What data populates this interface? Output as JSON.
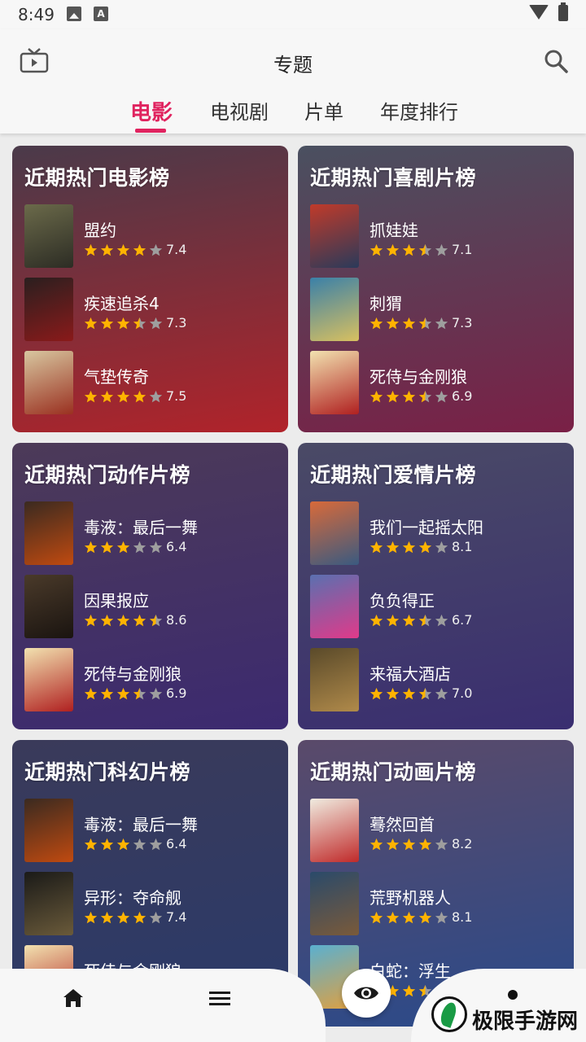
{
  "status": {
    "time": "8:49",
    "a_icon": "A"
  },
  "appbar": {
    "title": "专题"
  },
  "tabs": [
    {
      "label": "电影",
      "active": true
    },
    {
      "label": "电视剧",
      "active": false
    },
    {
      "label": "片单",
      "active": false
    },
    {
      "label": "年度排行",
      "active": false
    }
  ],
  "colors": {
    "accent": "#e0235f",
    "star": "#ffb300",
    "star_empty": "#9e9e9e"
  },
  "sections": [
    {
      "title": "近期热门电影榜",
      "bg": [
        "#4a3a4a",
        "#b1232a"
      ],
      "movies": [
        {
          "name": "盟约",
          "rating": "7.4",
          "stars": 4.0,
          "poster": [
            "#6b6a4a",
            "#2c2c24"
          ]
        },
        {
          "name": "疾速追杀4",
          "rating": "7.3",
          "stars": 3.5,
          "poster": [
            "#2a1f1f",
            "#8a1a1a"
          ]
        },
        {
          "name": "气垫传奇",
          "rating": "7.5",
          "stars": 4.0,
          "poster": [
            "#d8c7a0",
            "#9a3020"
          ]
        }
      ]
    },
    {
      "title": "近期热门喜剧片榜",
      "bg": [
        "#4a5060",
        "#7a2046"
      ],
      "movies": [
        {
          "name": "抓娃娃",
          "rating": "7.1",
          "stars": 3.5,
          "poster": [
            "#c03a2a",
            "#2a3a5a"
          ]
        },
        {
          "name": "刺猬",
          "rating": "7.3",
          "stars": 3.5,
          "poster": [
            "#3a80a8",
            "#d8c060"
          ]
        },
        {
          "name": "死侍与金刚狼",
          "rating": "6.9",
          "stars": 3.5,
          "poster": [
            "#f2e2b0",
            "#b02020"
          ]
        }
      ]
    },
    {
      "title": "近期热门动作片榜",
      "bg": [
        "#4c3a58",
        "#3c2a70"
      ],
      "movies": [
        {
          "name": "毒液：最后一舞",
          "rating": "6.4",
          "stars": 3.0,
          "poster": [
            "#3a2a20",
            "#c04a10"
          ]
        },
        {
          "name": "因果报应",
          "rating": "8.6",
          "stars": 4.5,
          "poster": [
            "#4a3a2a",
            "#1a1410"
          ]
        },
        {
          "name": "死侍与金刚狼",
          "rating": "6.9",
          "stars": 3.5,
          "poster": [
            "#f2e2b0",
            "#b02020"
          ]
        }
      ]
    },
    {
      "title": "近期热门爱情片榜",
      "bg": [
        "#4a4a66",
        "#3a2e70"
      ],
      "movies": [
        {
          "name": "我们一起摇太阳",
          "rating": "8.1",
          "stars": 4.0,
          "poster": [
            "#d86a3a",
            "#3a5a80"
          ]
        },
        {
          "name": "负负得正",
          "rating": "6.7",
          "stars": 3.5,
          "poster": [
            "#5a70b0",
            "#e03a8a"
          ]
        },
        {
          "name": "来福大酒店",
          "rating": "7.0",
          "stars": 3.5,
          "poster": [
            "#5a4a2a",
            "#b08a4a"
          ]
        }
      ]
    },
    {
      "title": "近期热门科幻片榜",
      "bg": [
        "#3a3a5a",
        "#2a3a6a"
      ],
      "movies": [
        {
          "name": "毒液：最后一舞",
          "rating": "6.4",
          "stars": 3.0,
          "poster": [
            "#3a2a20",
            "#c04a10"
          ]
        },
        {
          "name": "异形：夺命舰",
          "rating": "7.4",
          "stars": 4.0,
          "poster": [
            "#1a1a18",
            "#6a5a3a"
          ]
        },
        {
          "name": "死侍与金刚狼",
          "rating": "",
          "stars": 0,
          "poster": [
            "#f2e2b0",
            "#b02020"
          ]
        }
      ]
    },
    {
      "title": "近期热门动画片榜",
      "bg": [
        "#5a4a6a",
        "#2a4a8a"
      ],
      "movies": [
        {
          "name": "蓦然回首",
          "rating": "8.2",
          "stars": 4.0,
          "poster": [
            "#f0ece0",
            "#c02a2a"
          ]
        },
        {
          "name": "荒野机器人",
          "rating": "8.1",
          "stars": 4.0,
          "poster": [
            "#2a4a6a",
            "#7a5a3a"
          ]
        },
        {
          "name": "白蛇：浮生",
          "rating": "",
          "stars": 3.5,
          "poster": [
            "#5ab0d0",
            "#e0a040"
          ]
        }
      ]
    }
  ],
  "bottom_nav": [
    {
      "icon": "home-icon"
    },
    {
      "icon": "list-icon"
    },
    {
      "icon": "eye-icon"
    },
    {
      "icon": "dot-icon"
    }
  ],
  "watermark": {
    "text": "极限手游网"
  }
}
